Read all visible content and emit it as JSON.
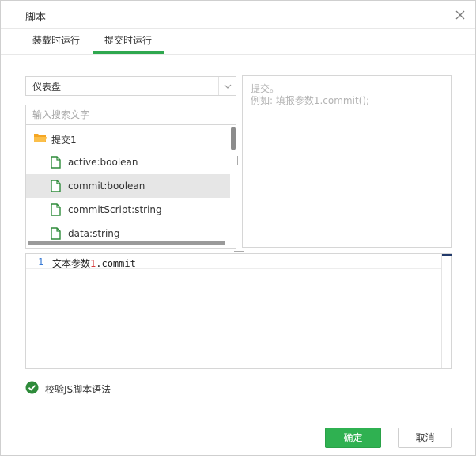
{
  "dialog": {
    "title": "脚本",
    "tabs": [
      {
        "label": "装载时运行",
        "active": false
      },
      {
        "label": "提交时运行",
        "active": true
      }
    ]
  },
  "left": {
    "select_value": "仪表盘",
    "search_placeholder": "输入搜索文字",
    "tree": [
      {
        "label": "提交1",
        "icon": "folder-icon",
        "selected": false
      },
      {
        "label": "active:boolean",
        "icon": "file-icon",
        "selected": false
      },
      {
        "label": "commit:boolean",
        "icon": "file-icon",
        "selected": true
      },
      {
        "label": "commitScript:string",
        "icon": "file-icon",
        "selected": false
      },
      {
        "label": "data:string",
        "icon": "file-icon",
        "selected": false
      }
    ]
  },
  "help": {
    "line1": "提交。",
    "line2": "例如: 填报参数1.commit();"
  },
  "editor": {
    "line_number": "1",
    "code_prefix": "文本参数",
    "code_number": "1",
    "code_suffix": ".commit"
  },
  "validate": {
    "label": "校验JS脚本语法",
    "checked": true
  },
  "footer": {
    "ok_label": "确定",
    "cancel_label": "取消"
  },
  "colors": {
    "accent_green": "#2fb151",
    "folder_orange": "#f5a623",
    "file_green": "#2e8b3a",
    "line_number_blue": "#3a7bd5"
  }
}
